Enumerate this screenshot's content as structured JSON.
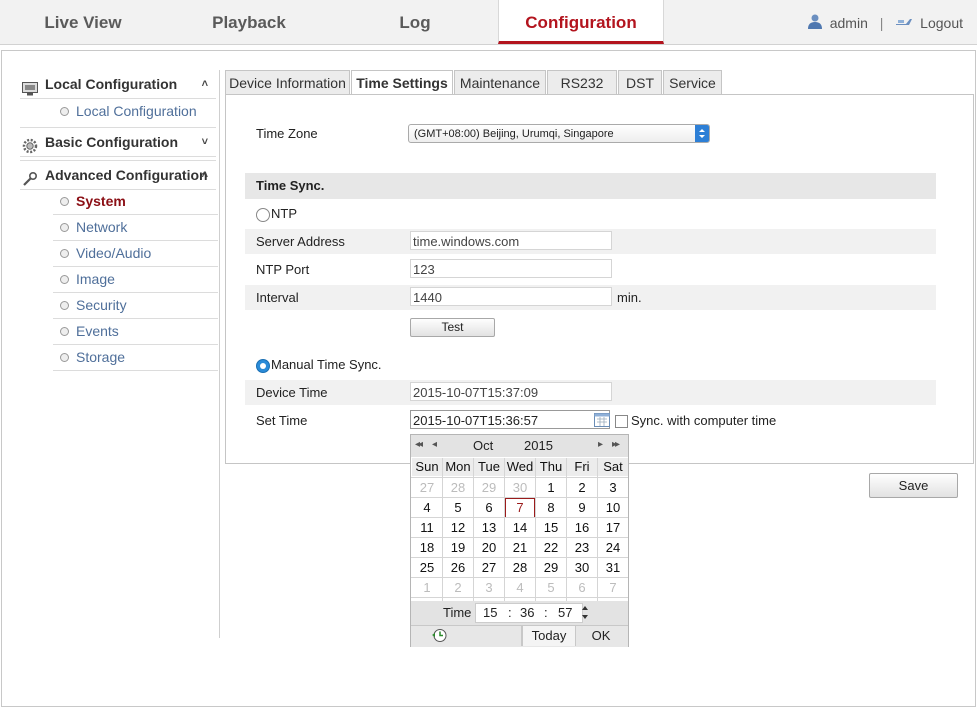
{
  "nav": {
    "tabs": [
      {
        "label": "Live View"
      },
      {
        "label": "Playback"
      },
      {
        "label": "Log"
      },
      {
        "label": "Configuration"
      }
    ],
    "user": "admin",
    "separator": "|",
    "logout": "Logout",
    "active_color": "#b3141e"
  },
  "sidebar": {
    "local": {
      "label": "Local Configuration",
      "chevron": "˄",
      "items": [
        {
          "label": "Local Configuration"
        }
      ]
    },
    "basic": {
      "label": "Basic Configuration",
      "chevron": "˅"
    },
    "advanced": {
      "label": "Advanced Configuration",
      "chevron": "˄",
      "items": [
        {
          "label": "System"
        },
        {
          "label": "Network"
        },
        {
          "label": "Video/Audio"
        },
        {
          "label": "Image"
        },
        {
          "label": "Security"
        },
        {
          "label": "Events"
        },
        {
          "label": "Storage"
        }
      ]
    }
  },
  "tabs": [
    {
      "label": "Device Information"
    },
    {
      "label": "Time Settings"
    },
    {
      "label": "Maintenance"
    },
    {
      "label": "RS232"
    },
    {
      "label": "DST"
    },
    {
      "label": "Service"
    }
  ],
  "form": {
    "time_zone_label": "Time Zone",
    "time_zone_value": "(GMT+08:00) Beijing, Urumqi, Singapore",
    "time_sync_title": "Time Sync.",
    "ntp_label": "NTP",
    "server_address_label": "Server Address",
    "server_address_value": "time.windows.com",
    "ntp_port_label": "NTP Port",
    "ntp_port_value": "123",
    "interval_label": "Interval",
    "interval_value": "1440",
    "interval_unit": "min.",
    "test_button": "Test",
    "manual_label": "Manual Time Sync.",
    "device_time_label": "Device Time",
    "device_time_value": "2015-10-07T15:37:09",
    "set_time_label": "Set Time",
    "set_time_value": "2015-10-07T15:36:57",
    "sync_computer_label": "Sync. with computer time",
    "save_button": "Save"
  },
  "calendar": {
    "prev_year": "◂◂",
    "prev_month": "◂",
    "month": "Oct",
    "year": "2015",
    "next_month": "▸",
    "next_year": "▸▸",
    "weekdays": [
      "Sun",
      "Mon",
      "Tue",
      "Wed",
      "Thu",
      "Fri",
      "Sat"
    ],
    "weeks": [
      [
        "27",
        "28",
        "29",
        "30",
        "1",
        "2",
        "3"
      ],
      [
        "4",
        "5",
        "6",
        "7",
        "8",
        "9",
        "10"
      ],
      [
        "11",
        "12",
        "13",
        "14",
        "15",
        "16",
        "17"
      ],
      [
        "18",
        "19",
        "20",
        "21",
        "22",
        "23",
        "24"
      ],
      [
        "25",
        "26",
        "27",
        "28",
        "29",
        "30",
        "31"
      ],
      [
        "1",
        "2",
        "3",
        "4",
        "5",
        "6",
        "7"
      ]
    ],
    "selected_day": "7",
    "time_label": "Time",
    "hour": "15",
    "minute": "36",
    "second": "57",
    "time_sep": ":",
    "today_button": "Today",
    "ok_button": "OK"
  }
}
